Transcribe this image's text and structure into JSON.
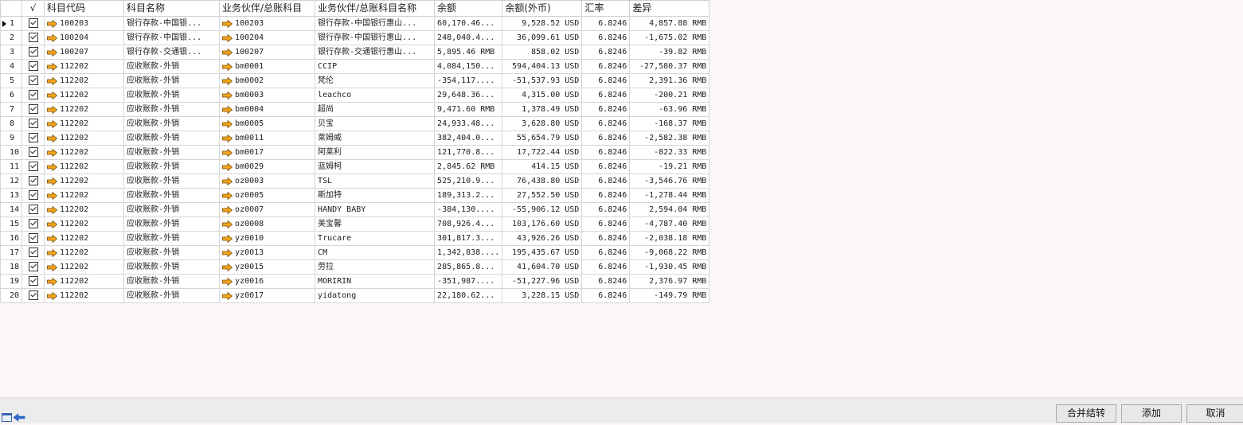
{
  "columns": {
    "check": "√",
    "subject_code": "科目代码",
    "subject_name": "科目名称",
    "partner_code": "业务伙伴/总账科目",
    "partner_name": "业务伙伴/总账科目名称",
    "balance": "余额",
    "balance_fx": "余额(外币)",
    "rate": "汇率",
    "diff": "差异"
  },
  "rows": [
    {
      "n": "1",
      "code": "100203",
      "name": "银行存款-中国银...",
      "pcode": "100203",
      "pname": "银行存款-中国银行惠山...",
      "bal": "60,170.46...",
      "fx": "9,528.52 USD",
      "rate": "6.8246",
      "diff": "4,857.88 RMB"
    },
    {
      "n": "2",
      "code": "100204",
      "name": "银行存款-中国银...",
      "pcode": "100204",
      "pname": "银行存款-中国银行惠山...",
      "bal": "248,040.4...",
      "fx": "36,099.61 USD",
      "rate": "6.8246",
      "diff": "-1,675.02 RMB"
    },
    {
      "n": "3",
      "code": "100207",
      "name": "银行存款-交通银...",
      "pcode": "100207",
      "pname": "银行存款-交通银行惠山...",
      "bal": "5,895.46 RMB",
      "fx": "858.02 USD",
      "rate": "6.8246",
      "diff": "-39.82 RMB"
    },
    {
      "n": "4",
      "code": "112202",
      "name": "应收账款-外销",
      "pcode": "bm0001",
      "pname": "CCIP",
      "bal": "4,084,150...",
      "fx": "594,404.13 USD",
      "rate": "6.8246",
      "diff": "-27,580.37 RMB"
    },
    {
      "n": "5",
      "code": "112202",
      "name": "应收账款-外销",
      "pcode": "bm0002",
      "pname": "梵伦",
      "bal": "-354,117....",
      "fx": "-51,537.93 USD",
      "rate": "6.8246",
      "diff": "2,391.36 RMB"
    },
    {
      "n": "6",
      "code": "112202",
      "name": "应收账款-外销",
      "pcode": "bm0003",
      "pname": "leachco",
      "bal": "29,648.36...",
      "fx": "4,315.00 USD",
      "rate": "6.8246",
      "diff": "-200.21 RMB"
    },
    {
      "n": "7",
      "code": "112202",
      "name": "应收账款-外销",
      "pcode": "bm0004",
      "pname": "超尚",
      "bal": "9,471.60 RMB",
      "fx": "1,378.49 USD",
      "rate": "6.8246",
      "diff": "-63.96 RMB"
    },
    {
      "n": "8",
      "code": "112202",
      "name": "应收账款-外销",
      "pcode": "bm0005",
      "pname": "贝宝",
      "bal": "24,933.48...",
      "fx": "3,628.80 USD",
      "rate": "6.8246",
      "diff": "-168.37 RMB"
    },
    {
      "n": "9",
      "code": "112202",
      "name": "应收账款-外销",
      "pcode": "bm0011",
      "pname": "莱姆威",
      "bal": "382,404.0...",
      "fx": "55,654.79 USD",
      "rate": "6.8246",
      "diff": "-2,582.38 RMB"
    },
    {
      "n": "10",
      "code": "112202",
      "name": "应收账款-外销",
      "pcode": "bm0017",
      "pname": "阿莱利",
      "bal": "121,770.8...",
      "fx": "17,722.44 USD",
      "rate": "6.8246",
      "diff": "-822.33 RMB"
    },
    {
      "n": "11",
      "code": "112202",
      "name": "应收账款-外销",
      "pcode": "bm0029",
      "pname": "蓝姆柯",
      "bal": "2,845.62 RMB",
      "fx": "414.15 USD",
      "rate": "6.8246",
      "diff": "-19.21 RMB"
    },
    {
      "n": "12",
      "code": "112202",
      "name": "应收账款-外销",
      "pcode": "oz0003",
      "pname": "TSL",
      "bal": "525,210.9...",
      "fx": "76,438.80 USD",
      "rate": "6.8246",
      "diff": "-3,546.76 RMB"
    },
    {
      "n": "13",
      "code": "112202",
      "name": "应收账款-外销",
      "pcode": "oz0005",
      "pname": "斯加特",
      "bal": "189,313.2...",
      "fx": "27,552.50 USD",
      "rate": "6.8246",
      "diff": "-1,278.44 RMB"
    },
    {
      "n": "14",
      "code": "112202",
      "name": "应收账款-外销",
      "pcode": "oz0007",
      "pname": "HANDY BABY",
      "bal": "-384,130....",
      "fx": "-55,906.12 USD",
      "rate": "6.8246",
      "diff": "2,594.04 RMB"
    },
    {
      "n": "15",
      "code": "112202",
      "name": "应收账款-外销",
      "pcode": "oz0008",
      "pname": "美宝馨",
      "bal": "708,926.4...",
      "fx": "103,176.60 USD",
      "rate": "6.8246",
      "diff": "-4,787.40 RMB"
    },
    {
      "n": "16",
      "code": "112202",
      "name": "应收账款-外销",
      "pcode": "yz0010",
      "pname": "Trucare",
      "bal": "301,817.3...",
      "fx": "43,926.26 USD",
      "rate": "6.8246",
      "diff": "-2,038.18 RMB"
    },
    {
      "n": "17",
      "code": "112202",
      "name": "应收账款-外销",
      "pcode": "yz0013",
      "pname": "CM",
      "bal": "1,342,838....",
      "fx": "195,435.67 USD",
      "rate": "6.8246",
      "diff": "-9,068.22 RMB"
    },
    {
      "n": "18",
      "code": "112202",
      "name": "应收账款-外销",
      "pcode": "yz0015",
      "pname": "劳拉",
      "bal": "285,865.8...",
      "fx": "41,604.70 USD",
      "rate": "6.8246",
      "diff": "-1,930.45 RMB"
    },
    {
      "n": "19",
      "code": "112202",
      "name": "应收账款-外销",
      "pcode": "yz0016",
      "pname": "MORIRIN",
      "bal": "-351,987....",
      "fx": "-51,227.96 USD",
      "rate": "6.8246",
      "diff": "2,376.97 RMB"
    },
    {
      "n": "20",
      "code": "112202",
      "name": "应收账款-外销",
      "pcode": "yz0017",
      "pname": "yidatong",
      "bal": "22,180.62...",
      "fx": "3,228.15 USD",
      "rate": "6.8246",
      "diff": "-149.79 RMB"
    }
  ],
  "buttons": {
    "merge_transfer": "合并结转",
    "add": "添加",
    "cancel": "取消"
  },
  "icons": {
    "row_link": "arrow-right-icon",
    "check": "checkbox-checked-icon",
    "nav": "back-window-icon"
  },
  "colors": {
    "arrow": "#f3a61c",
    "selected_cell": "#f7c94a"
  }
}
